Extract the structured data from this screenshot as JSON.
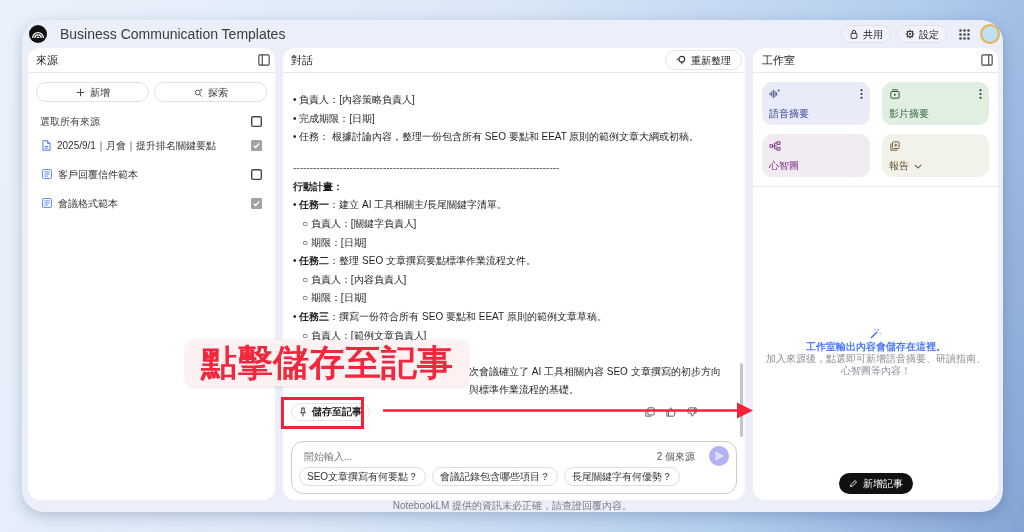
{
  "app": {
    "title": "Business Communication Templates"
  },
  "header_actions": [
    {
      "kind": "share",
      "label": "共用"
    },
    {
      "kind": "settings",
      "label": "設定"
    }
  ],
  "sources": {
    "title": "來源",
    "buttons": [
      {
        "kind": "add",
        "label": "新增"
      },
      {
        "kind": "discover",
        "label": "探索"
      }
    ],
    "select_all": {
      "label": "選取所有來源",
      "checked": false
    },
    "items": [
      {
        "kind": "file",
        "title": "2025/9/1｜月會｜提升排名關鍵要點",
        "checked": true
      },
      {
        "kind": "note",
        "title": "客戶回覆信件範本",
        "checked": false
      },
      {
        "kind": "note",
        "title": "會議格式範本",
        "checked": true
      }
    ]
  },
  "chat": {
    "title": "對話",
    "refresh_button": "重新整理",
    "lines": [
      {
        "kind": "bullet",
        "text": "• 負責人：[內容策略負責人]"
      },
      {
        "kind": "bullet",
        "text": "• 完成期限：[日期]"
      },
      {
        "kind": "bullet",
        "text": "• 任務： 根據討論內容，整理一份包含所有 SEO 要點和 EEAT 原則的範例文章大綱或初稿。"
      },
      {
        "kind": "divider",
        "text": "--------------------------------------------------------------------------------"
      },
      {
        "kind": "heading",
        "text": "行動計畫："
      },
      {
        "kind": "bullet",
        "text": "• **任務一**：建立 AI 工具相關主/長尾關鍵字清單。"
      },
      {
        "kind": "sub",
        "text": "○ 負責人：[關鍵字負責人]"
      },
      {
        "kind": "sub",
        "text": "○ 期限：[日期]"
      },
      {
        "kind": "bullet",
        "text": "• **任務二**：整理 SEO 文章撰寫要點標準作業流程文件。"
      },
      {
        "kind": "sub",
        "text": "○ 負責人：[內容負責人]"
      },
      {
        "kind": "sub",
        "text": "○ 期限：[日期]"
      },
      {
        "kind": "bullet",
        "text": "• **任務三**：撰寫一份符合所有 SEO 要點和 EEAT 原則的範例文章草稿。"
      },
      {
        "kind": "sub",
        "text": "○ 負責人：[範例文章負責人]"
      },
      {
        "kind": "continuation",
        "text": "次會議確立了 AI 工具相關內容 SEO 文章撰寫的初步方向與標準作業流程的基礎。"
      }
    ],
    "save_button": "儲存至記事",
    "composer": {
      "placeholder": "開始輸入...",
      "source_count": "2 個來源",
      "suggestions": [
        "SEO文章撰寫有何要點？",
        "會議記錄包含哪些項目？",
        "長尾關鍵字有何優勢？"
      ]
    }
  },
  "studio": {
    "title": "工作室",
    "tools": [
      {
        "kind": "audio",
        "label": "語音摘要"
      },
      {
        "kind": "video",
        "label": "影片摘要"
      },
      {
        "kind": "mindmap",
        "label": "心智圖"
      },
      {
        "kind": "report",
        "label": "報告"
      }
    ],
    "empty_title": "工作室輸出內容會儲存在這裡。",
    "empty_hint": "加入來源後，點選即可新增語音摘要、研讀指南、心智圖等內容！",
    "add_note_button": "新增記事"
  },
  "footer": "NotebookLM 提供的資訊未必正確，請查證回覆內容。",
  "annotation": {
    "label": "點擊儲存至記事"
  }
}
